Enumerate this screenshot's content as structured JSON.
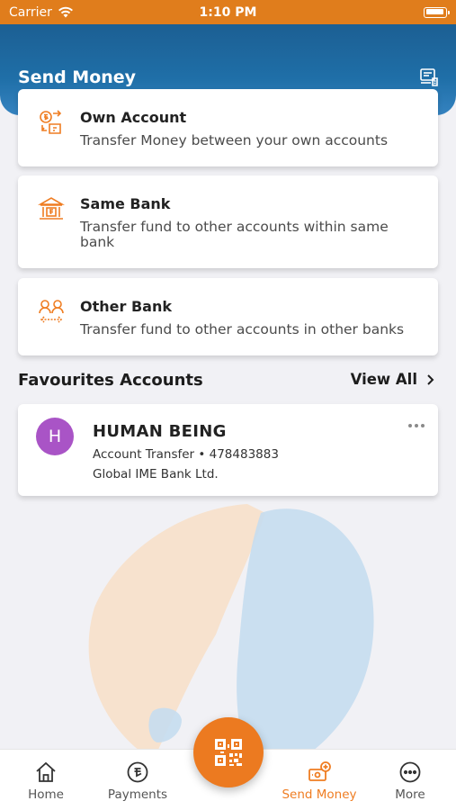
{
  "status_bar": {
    "carrier": "Carrier",
    "time": "1:10 PM"
  },
  "header": {
    "title": "Send Money",
    "icon": "statement-icon"
  },
  "options": [
    {
      "title": "Own Account",
      "description": "Transfer Money between your own accounts",
      "icon": "own-account-icon"
    },
    {
      "title": "Same Bank",
      "description": "Transfer fund to other accounts within same bank",
      "icon": "bank-icon"
    },
    {
      "title": "Other Bank",
      "description": "Transfer fund to other accounts in other banks",
      "icon": "users-transfer-icon"
    }
  ],
  "favourites": {
    "title": "Favourites Accounts",
    "view_all": "View All",
    "items": [
      {
        "initial": "H",
        "name": "HUMAN BEING",
        "detail": "Account Transfer • 478483883",
        "bank": "Global IME Bank Ltd.",
        "avatar_color": "#a954c6"
      }
    ]
  },
  "bottom_nav": {
    "items": [
      {
        "label": "Home",
        "icon": "home-icon"
      },
      {
        "label": "Payments",
        "icon": "payments-icon"
      },
      {
        "label": "Send Money",
        "icon": "send-money-icon",
        "active": true
      },
      {
        "label": "More",
        "icon": "more-icon"
      }
    ],
    "center_button": {
      "icon": "qr-code-icon"
    }
  },
  "colors": {
    "accent": "#ec7a20",
    "header": "#1f6fa8",
    "status_bar": "#e07d1c"
  }
}
